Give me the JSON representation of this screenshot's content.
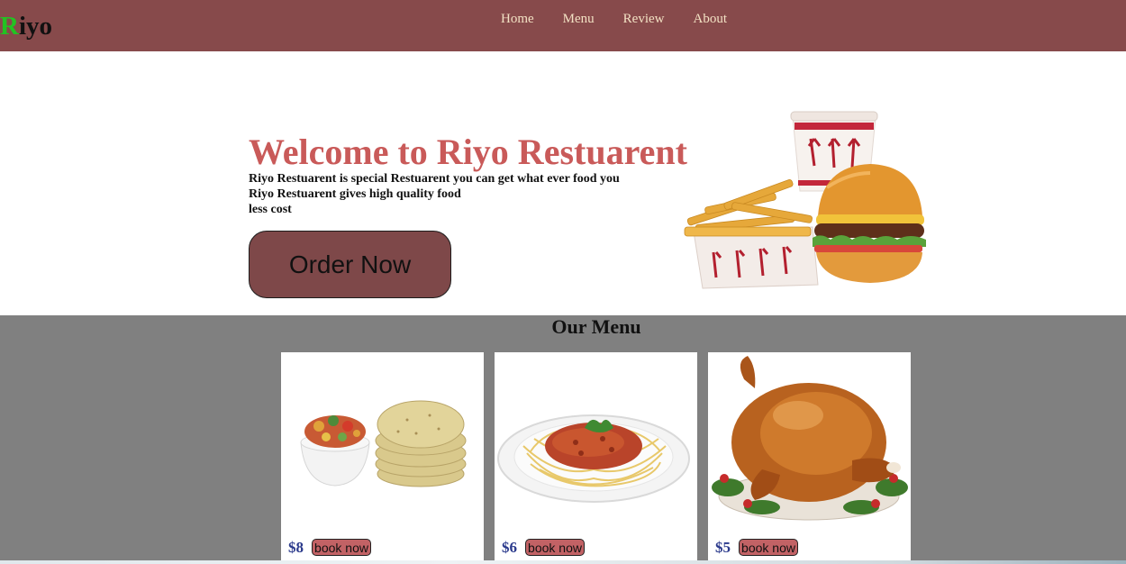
{
  "brand": {
    "first_letter": "R",
    "rest": "iyo"
  },
  "nav": {
    "items": [
      "Home",
      "Menu",
      "Review",
      "About"
    ]
  },
  "hero": {
    "title": "Welcome to Riyo Restuarent",
    "lines": [
      "Riyo Restuarent is special Restuarent you can get what ever food you",
      "Riyo Restuarent gives high quality food",
      "less cost"
    ],
    "cta": "Order Now",
    "image_icon": "burger-fries-drink-image"
  },
  "menu": {
    "title": "Our Menu",
    "items": [
      {
        "image_icon": "tortilla-salsa-image",
        "price": "$8",
        "button": "book now"
      },
      {
        "image_icon": "spaghetti-plate-image",
        "price": "$6",
        "button": "book now"
      },
      {
        "image_icon": "roast-turkey-image",
        "price": "$5",
        "button": "book now"
      }
    ]
  },
  "colors": {
    "navbar": "#874a4b",
    "nav_text": "#f3e2c4",
    "logo_accent": "#22c322",
    "hero_title": "#c95a59",
    "order_button": "#7e4849",
    "menu_background": "#808080",
    "price": "#2b3a8c",
    "book_button": "#c26265"
  }
}
